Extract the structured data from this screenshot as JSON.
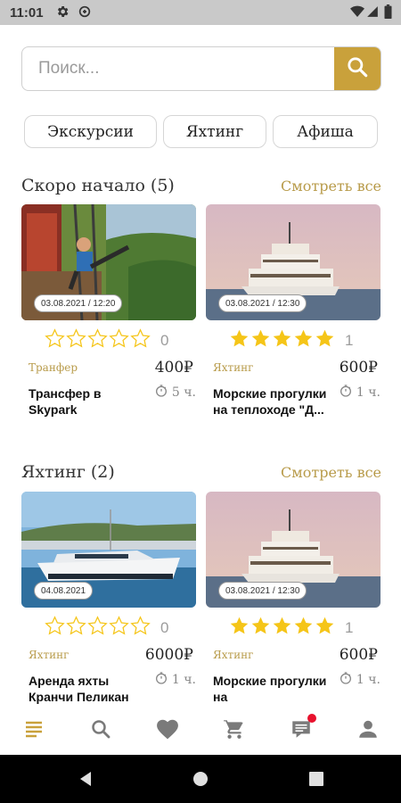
{
  "status_bar": {
    "time": "11:01"
  },
  "search": {
    "placeholder": "Поиск..."
  },
  "chips": [
    {
      "label": "Экскурсии"
    },
    {
      "label": "Яхтинг"
    },
    {
      "label": "Афиша"
    }
  ],
  "sections": [
    {
      "title": "Скоро начало (5)",
      "see_all": "Смотреть все",
      "cards": [
        {
          "date": "03.08.2021 / 12:20",
          "rating": 0,
          "rating_count": "0",
          "category": "Транфер",
          "price": "400₽",
          "title": "Трансфер в Skypark",
          "duration": "5 ч."
        },
        {
          "date": "03.08.2021 / 12:30",
          "rating": 5,
          "rating_count": "1",
          "category": "Яхтинг",
          "price": "600₽",
          "title": "Морские прогулки на теплоходе \"Д...",
          "duration": "1 ч."
        }
      ]
    },
    {
      "title": "Яхтинг (2)",
      "see_all": "Смотреть все",
      "cards": [
        {
          "date": "04.08.2021",
          "rating": 0,
          "rating_count": "0",
          "category": "Яхтинг",
          "price": "6000₽",
          "title": "Аренда яхты Кранчи Пеликан",
          "duration": "1 ч."
        },
        {
          "date": "03.08.2021 / 12:30",
          "rating": 5,
          "rating_count": "1",
          "category": "Яхтинг",
          "price": "600₽",
          "title": "Морские прогулки на",
          "duration": "1 ч."
        }
      ]
    }
  ],
  "icons": {
    "bottom_nav": [
      "menu-icon",
      "search-icon",
      "heart-icon",
      "cart-icon",
      "chat-icon",
      "profile-icon"
    ],
    "system_nav": [
      "back-icon",
      "home-icon",
      "recents-icon"
    ]
  },
  "colors": {
    "accent": "#c9a13b",
    "star_filled": "#f5c518",
    "notification_dot": "#e8112d",
    "nav_active": "#c9a13b",
    "nav_inactive": "#7a7a7a"
  }
}
